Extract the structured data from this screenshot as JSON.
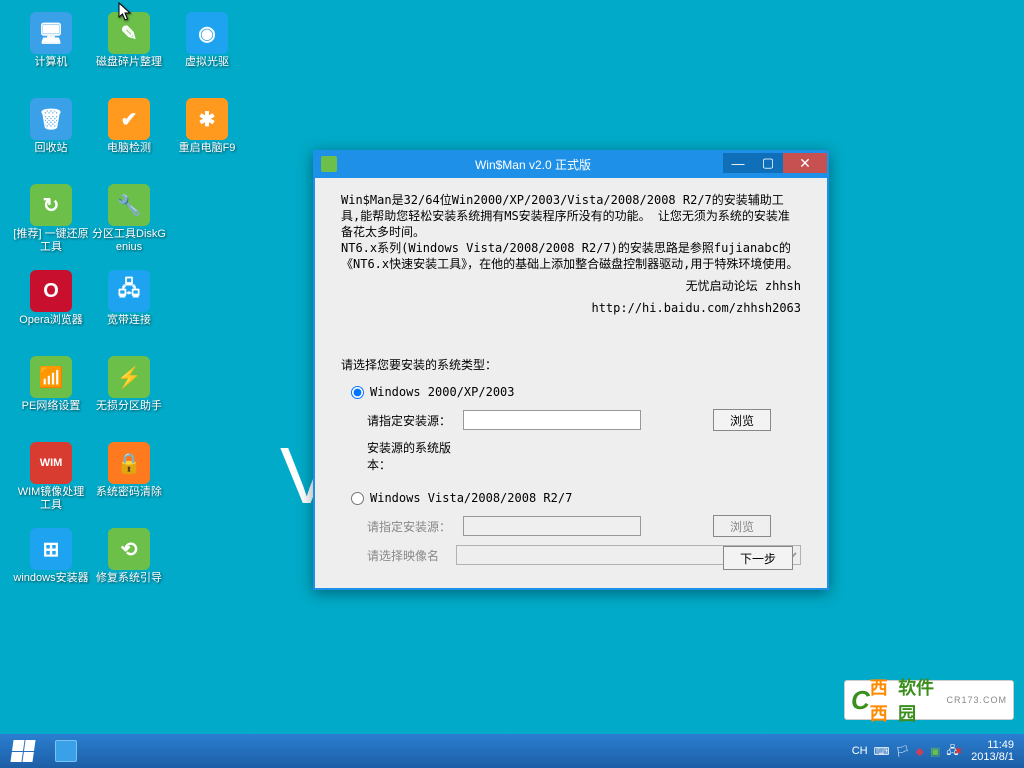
{
  "desktop": {
    "icons": [
      {
        "label": "计算机",
        "bg": "#3aa0e8",
        "glyph": "🖥"
      },
      {
        "label": "磁盘碎片整理",
        "bg": "#6cc04a",
        "glyph": "✎"
      },
      {
        "label": "虚拟光驱",
        "bg": "#1ea3f0",
        "glyph": "◉"
      },
      {
        "label": "回收站",
        "bg": "#3aa0e8",
        "glyph": "🗑"
      },
      {
        "label": "电脑检测",
        "bg": "#ff9a1f",
        "glyph": "✔"
      },
      {
        "label": "重启电脑F9",
        "bg": "#ff9a1f",
        "glyph": "✱"
      },
      {
        "label": "[推荐] 一键还原工具",
        "bg": "#6cc04a",
        "glyph": "↻"
      },
      {
        "label": "分区工具DiskGenius",
        "bg": "#6cc04a",
        "glyph": "🔧"
      },
      {
        "label": "",
        "bg": "transparent",
        "glyph": ""
      },
      {
        "label": "Opera浏览器",
        "bg": "#c8102e",
        "glyph": "O"
      },
      {
        "label": "宽带连接",
        "bg": "#1ea3f0",
        "glyph": "🖧"
      },
      {
        "label": "",
        "bg": "transparent",
        "glyph": ""
      },
      {
        "label": "PE网络设置",
        "bg": "#6cc04a",
        "glyph": "📶"
      },
      {
        "label": "无损分区助手",
        "bg": "#6cc04a",
        "glyph": "⚡"
      },
      {
        "label": "",
        "bg": "transparent",
        "glyph": ""
      },
      {
        "label": "WIM镜像处理工具",
        "bg": "#d83b2f",
        "glyph": "WIM"
      },
      {
        "label": "系统密码清除",
        "bg": "#ff7a1f",
        "glyph": "🔒"
      },
      {
        "label": "",
        "bg": "transparent",
        "glyph": ""
      },
      {
        "label": "windows安装器",
        "bg": "#1ea3f0",
        "glyph": "⊞"
      },
      {
        "label": "修复系统引导",
        "bg": "#6cc04a",
        "glyph": "⟲"
      }
    ],
    "bg_text": "V"
  },
  "watermark": {
    "brand1": "西西",
    "brand2": "软件园",
    "sub": "CR173.COM"
  },
  "window": {
    "title": "Win$Man v2.0 正式版",
    "desc_line1": "Win$Man是32/64位Win2000/XP/2003/Vista/2008/2008 R2/7的安装辅助工具,能帮助您轻松安装系统拥有MS安装程序所没有的功能。 让您无须为系统的安装准备花太多时间。",
    "desc_line2": "NT6.x系列(Windows Vista/2008/2008 R2/7)的安装思路是参照fujianabc的《NT6.x快速安装工具》，在他的基础上添加整合磁盘控制器驱动,用于特殊环境使用。",
    "sig1": "无忧启动论坛 zhhsh",
    "sig2": "http://hi.baidu.com/zhhsh2063",
    "select_title": "请选择您要安装的系统类型：",
    "opt1_label": "Windows 2000/XP/2003",
    "opt2_label": "Windows Vista/2008/2008 R2/7",
    "src_label": "请指定安装源：",
    "src_value": "",
    "browse": "浏览",
    "src_ver": "安装源的系统版本：",
    "img_label": "请选择映像名",
    "next": "下一步"
  },
  "taskbar": {
    "lang": "CH",
    "time": "11:49",
    "date": "2013/8/1"
  }
}
